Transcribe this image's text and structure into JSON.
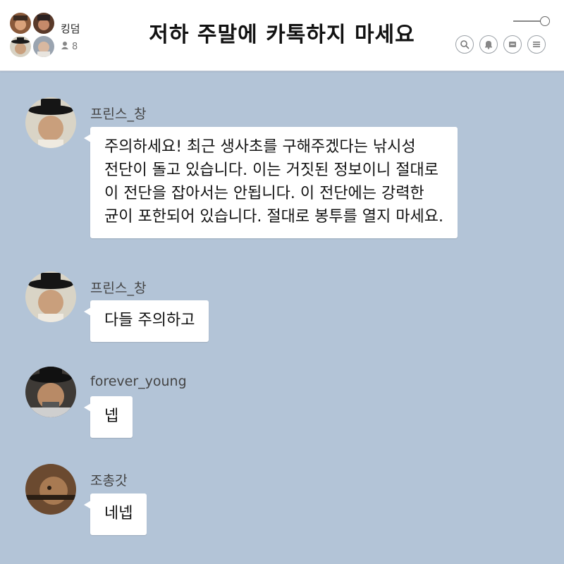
{
  "header": {
    "room_name": "킹덤",
    "member_count": "8",
    "title": "저하 주말에 카톡하지 마세요"
  },
  "icons": [
    "search-icon",
    "bell-icon",
    "drawer-icon",
    "menu-icon"
  ],
  "messages": [
    {
      "sender": "프린스_창",
      "lines": [
        "주의하세요! 최근 생사초를 구해주겠다는 낚시성",
        "전단이 돌고 있습니다. 이는 거짓된 정보이니 절대로",
        "이 전단을 잡아서는 안됩니다. 이 전단에는 강력한",
        "균이 포한되어 있습니다. 절대로 봉투를 열지 마세요."
      ]
    },
    {
      "sender": "프린스_창",
      "lines": [
        "다들 주의하고"
      ]
    },
    {
      "sender": "forever_young",
      "lines": [
        "넵"
      ]
    },
    {
      "sender": "조총갓",
      "lines": [
        "네넵"
      ]
    }
  ],
  "colors": {
    "background": "#b3c4d7",
    "bubble": "#ffffff",
    "header": "#ffffff"
  }
}
